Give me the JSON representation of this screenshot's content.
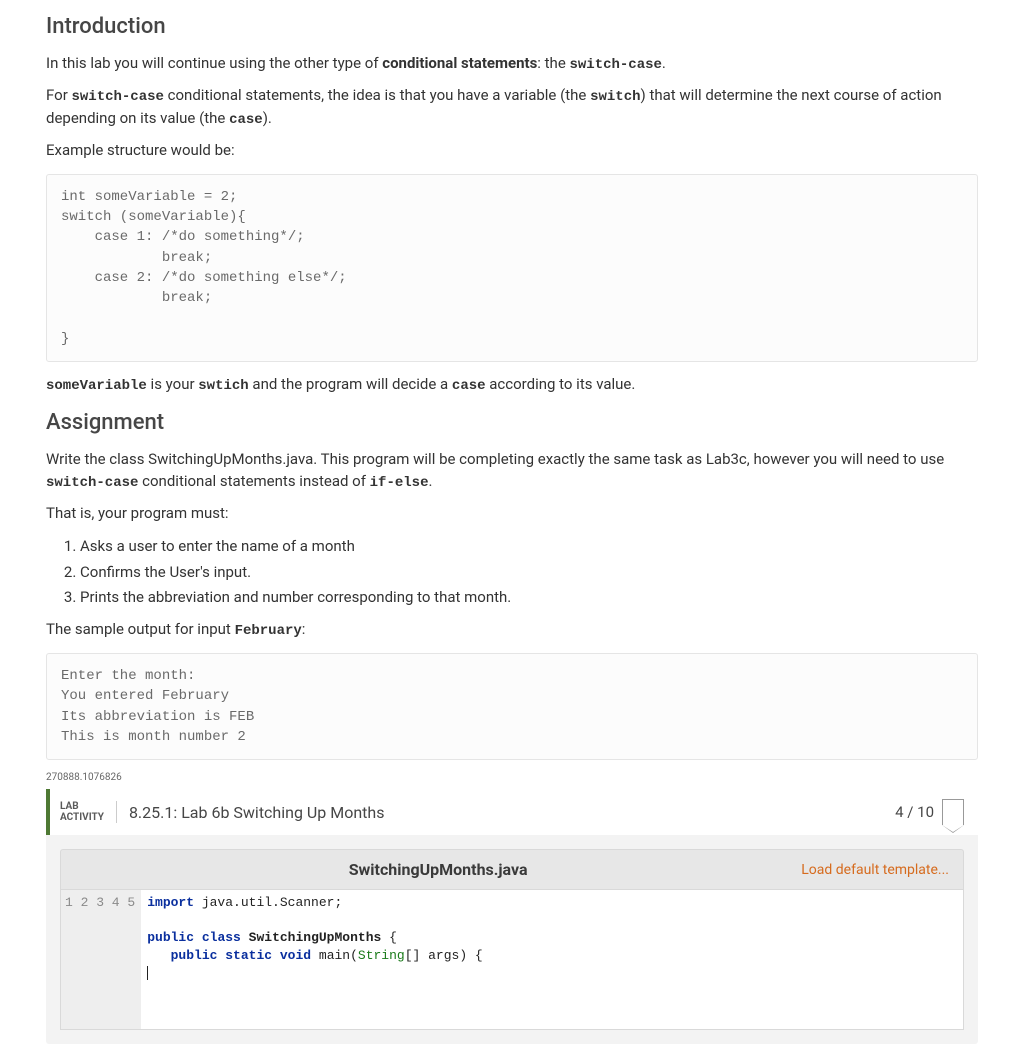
{
  "intro": {
    "heading": "Introduction",
    "p1_a": "In this lab you will continue using the other type of ",
    "p1_b": "conditional statements",
    "p1_c": ": the ",
    "p1_d": "switch-case",
    "p1_e": ".",
    "p2_a": "For ",
    "p2_b": "switch-case",
    "p2_c": " conditional statements, the idea is that you have a variable (the ",
    "p2_d": "switch",
    "p2_e": ") that will determine the next course of action depending on its value (the ",
    "p2_f": "case",
    "p2_g": ").",
    "p3": "Example structure would be:",
    "code1": "int someVariable = 2;\nswitch (someVariable){\n    case 1: /*do something*/;\n            break;\n    case 2: /*do something else*/;\n            break;\n\n}",
    "p4_a": "someVariable",
    "p4_b": " is your ",
    "p4_c": "swtich",
    "p4_d": " and the program will decide a ",
    "p4_e": "case",
    "p4_f": " according to its value."
  },
  "assign": {
    "heading": "Assignment",
    "p1_a": "Write the class SwitchingUpMonths.java. This program will be completing exactly the same task as Lab3c, however you will need to use ",
    "p1_b": "switch-case",
    "p1_c": " conditional statements instead of ",
    "p1_d": "if-else",
    "p1_e": ".",
    "p2": "That is, your program must:",
    "li1": "Asks a user to enter the name of a month",
    "li2": "Confirms the User's input.",
    "li3": "Prints the abbreviation and number corresponding to that month.",
    "p3_a": "The sample output for input ",
    "p3_b": "February",
    "p3_c": ":",
    "code2": "Enter the month:\nYou entered February\nIts abbreviation is FEB\nThis is month number 2"
  },
  "lab": {
    "id": "270888.1076826",
    "type_l1": "LAB",
    "type_l2": "ACTIVITY",
    "title": "8.25.1: Lab 6b Switching Up Months",
    "score": "4 / 10",
    "filename": "SwitchingUpMonths.java",
    "load_tpl": "Load default template...",
    "gutter": "1\n2\n3\n4\n5",
    "code": {
      "l1_a": "import",
      "l1_b": " java.util.Scanner;",
      "l3_a": "public",
      "l3_b": "class",
      "l3_c": "SwitchingUpMonths",
      "l3_d": " {",
      "l4_a": "public",
      "l4_b": "static",
      "l4_c": "void",
      "l4_d": " main(",
      "l4_e": "String",
      "l4_f": "[] args) {"
    }
  }
}
